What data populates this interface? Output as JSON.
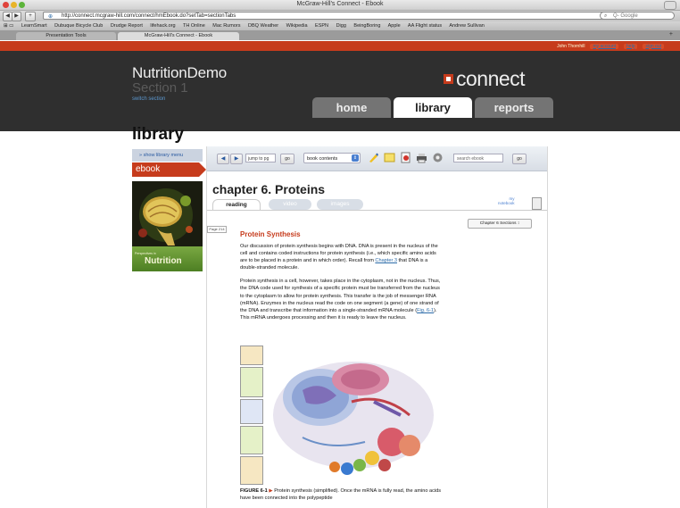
{
  "browser": {
    "window_title": "McGraw-Hill's Connect - Ebook",
    "url": "http://connect.mcgraw-hill.com/connect/hmEbook.do?setTab=sectionTabs",
    "search_placeholder": "Q- Google",
    "bookmarks": [
      "LearnSmart",
      "Dubuque Bicycle Club",
      "Drudge Report",
      "lifehack.org",
      "TH Online",
      "Mac Rumors",
      "DBQ Weather",
      "Wikipedia",
      "ESPN",
      "Digg",
      "BeingBoring",
      "Apple",
      "AA Flight status",
      "Andrew Sullivan"
    ],
    "tabs": [
      "Presentation Tools",
      "McGraw-Hill's Connect - Ebook"
    ]
  },
  "topnav": {
    "user": "John Thornhill",
    "my_account": "my account",
    "help": "help",
    "sign_out": "sign out"
  },
  "header": {
    "course": "NutritionDemo",
    "section": "Section 1",
    "switch": "switch section",
    "logo": "connect",
    "nav": [
      "home",
      "library",
      "reports"
    ]
  },
  "page": {
    "title": "library"
  },
  "sidebar": {
    "show_menu": "» show library menu",
    "ebook": "ebook",
    "cover_small": "Perspectives in",
    "cover_title": "Nutrition"
  },
  "reader": {
    "jump_placeholder": "jump to pg",
    "go": "go",
    "contents": "book contents",
    "search_placeholder": "search ebook",
    "chapter": "chapter 6.   Proteins",
    "tabs": [
      "reading",
      "video",
      "images"
    ],
    "my_notebook_1": "my",
    "my_notebook_2": "notebook",
    "sections_dropdown": "Chapter 6 Sections ↕",
    "page_label": "Page 214",
    "heading": "Protein Synthesis",
    "para1_a": "Our discussion of protein synthesis begins with DNA. DNA is present in the nucleus of the cell and contains coded instructions for protein synthesis (i.e., which specific amino acids are to be placed in a protein and in which order). Recall from ",
    "para1_link": "Chapter 3",
    "para1_b": " that DNA is a double-stranded molecule.",
    "para2_a": "Protein synthesis in a cell, however, takes place in the cytoplasm, not in the nucleus. Thus, the DNA code used for synthesis of a specific protein must be transferred from the nucleus to the cytoplasm to allow for protein synthesis. This transfer is the job of messenger RNA (mRNA). Enzymes in the nucleus read the code on one segment (a gene) of one strand of the DNA and transcribe that information into a single-stranded mRNA molecule (",
    "para2_link": "Fig. 6-1",
    "para2_b": "). This mRNA undergoes processing and then it is ready to leave the nucleus.",
    "caption_label": "FIGURE 6-1",
    "caption_text": " Protein synthesis (simplified). Once the mRNA is fully read, the amino acids have been connected into the polypeptide"
  },
  "colors": {
    "brand_red": "#c63b1c",
    "header_dark": "#2f2f2f",
    "link_blue": "#2a6aa8"
  }
}
